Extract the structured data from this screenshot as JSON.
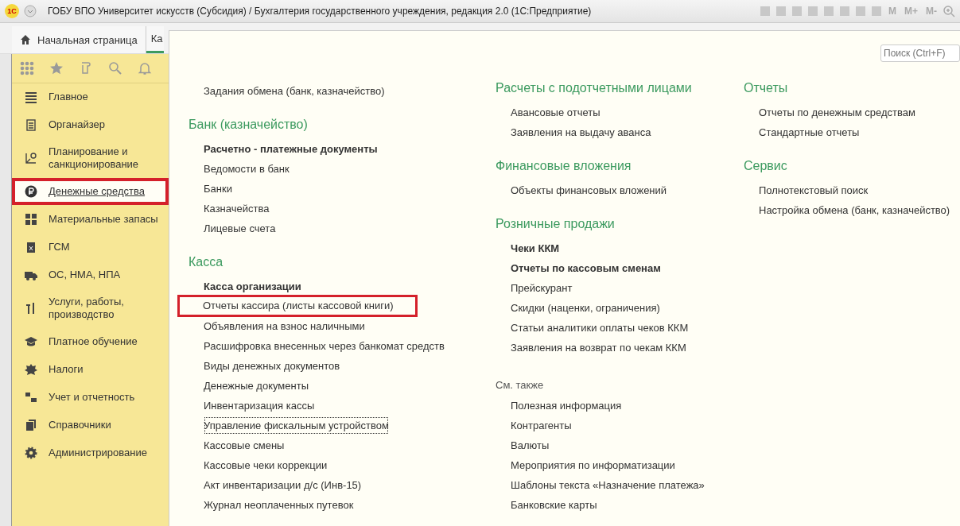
{
  "window": {
    "title": "ГОБУ ВПО Университет искусств (Субсидия) / Бухгалтерия государственного учреждения, редакция 2.0  (1С:Предприятие)",
    "logo": "1С",
    "memory_buttons": [
      "M",
      "M+",
      "M-"
    ]
  },
  "tabs": [
    {
      "label": "Начальная страница",
      "selected": false
    },
    {
      "label": "Ка",
      "selected": true
    }
  ],
  "sidebar": {
    "items": [
      {
        "label": "Главное",
        "selected": false,
        "marked": false
      },
      {
        "label": "Органайзер",
        "selected": false,
        "marked": false
      },
      {
        "label": "Планирование и санкционирование",
        "selected": false,
        "marked": false
      },
      {
        "label": "Денежные средства",
        "selected": true,
        "marked": true
      },
      {
        "label": "Материальные запасы",
        "selected": false,
        "marked": false
      },
      {
        "label": "ГСМ",
        "selected": false,
        "marked": false
      },
      {
        "label": "ОС, НМА, НПА",
        "selected": false,
        "marked": false
      },
      {
        "label": "Услуги, работы, производство",
        "selected": false,
        "marked": false
      },
      {
        "label": "Платное обучение",
        "selected": false,
        "marked": false
      },
      {
        "label": "Налоги",
        "selected": false,
        "marked": false
      },
      {
        "label": "Учет и отчетность",
        "selected": false,
        "marked": false
      },
      {
        "label": "Справочники",
        "selected": false,
        "marked": false
      },
      {
        "label": "Администрирование",
        "selected": false,
        "marked": false
      }
    ]
  },
  "search": {
    "placeholder": "Поиск (Ctrl+F)"
  },
  "columns": [
    {
      "sections": [
        {
          "kind": "plain",
          "items": [
            {
              "label": "Задания обмена (банк, казначейство)",
              "bold": false,
              "marked": false,
              "focused": false
            }
          ]
        },
        {
          "kind": "group",
          "title": "Банк (казначейство)",
          "items": [
            {
              "label": "Расчетно - платежные документы",
              "bold": true,
              "marked": false,
              "focused": false
            },
            {
              "label": "Ведомости в банк",
              "bold": false,
              "marked": false,
              "focused": false
            },
            {
              "label": "Банки",
              "bold": false,
              "marked": false,
              "focused": false
            },
            {
              "label": "Казначейства",
              "bold": false,
              "marked": false,
              "focused": false
            },
            {
              "label": "Лицевые счета",
              "bold": false,
              "marked": false,
              "focused": false
            }
          ]
        },
        {
          "kind": "group",
          "title": "Касса",
          "items": [
            {
              "label": "Касса организации",
              "bold": true,
              "marked": false,
              "focused": false
            },
            {
              "label": "Отчеты кассира (листы кассовой книги)",
              "bold": false,
              "marked": true,
              "focused": false
            },
            {
              "label": "Объявления на взнос наличными",
              "bold": false,
              "marked": false,
              "focused": false
            },
            {
              "label": "Расшифровка внесенных через банкомат средств",
              "bold": false,
              "marked": false,
              "focused": false
            },
            {
              "label": "Виды денежных документов",
              "bold": false,
              "marked": false,
              "focused": false
            },
            {
              "label": "Денежные документы",
              "bold": false,
              "marked": false,
              "focused": false
            },
            {
              "label": "Инвентаризация кассы",
              "bold": false,
              "marked": false,
              "focused": false
            },
            {
              "label": "Управление фискальным устройством",
              "bold": false,
              "marked": false,
              "focused": true
            },
            {
              "label": "Кассовые смены",
              "bold": false,
              "marked": false,
              "focused": false
            },
            {
              "label": "Кассовые чеки коррекции",
              "bold": false,
              "marked": false,
              "focused": false
            },
            {
              "label": "Акт инвентаризации д/с (Инв-15)",
              "bold": false,
              "marked": false,
              "focused": false
            },
            {
              "label": "Журнал неоплаченных путевок",
              "bold": false,
              "marked": false,
              "focused": false
            }
          ]
        }
      ]
    },
    {
      "sections": [
        {
          "kind": "group",
          "title": "Расчеты с подотчетными лицами",
          "items": [
            {
              "label": "Авансовые отчеты",
              "bold": false,
              "marked": false,
              "focused": false
            },
            {
              "label": "Заявления на выдачу аванса",
              "bold": false,
              "marked": false,
              "focused": false
            }
          ]
        },
        {
          "kind": "group",
          "title": "Финансовые вложения",
          "items": [
            {
              "label": "Объекты финансовых вложений",
              "bold": false,
              "marked": false,
              "focused": false
            }
          ]
        },
        {
          "kind": "group",
          "title": "Розничные продажи",
          "items": [
            {
              "label": "Чеки ККМ",
              "bold": true,
              "marked": false,
              "focused": false
            },
            {
              "label": "Отчеты по кассовым сменам",
              "bold": true,
              "marked": false,
              "focused": false
            },
            {
              "label": "Прейскурант",
              "bold": false,
              "marked": false,
              "focused": false
            },
            {
              "label": "Скидки (наценки, ограничения)",
              "bold": false,
              "marked": false,
              "focused": false
            },
            {
              "label": "Статьи аналитики оплаты чеков ККМ",
              "bold": false,
              "marked": false,
              "focused": false
            },
            {
              "label": "Заявления на возврат по чекам ККМ",
              "bold": false,
              "marked": false,
              "focused": false
            }
          ]
        },
        {
          "kind": "see_also",
          "title": "См. также",
          "items": [
            {
              "label": "Полезная информация",
              "bold": false,
              "marked": false,
              "focused": false
            },
            {
              "label": "Контрагенты",
              "bold": false,
              "marked": false,
              "focused": false
            },
            {
              "label": "Валюты",
              "bold": false,
              "marked": false,
              "focused": false
            },
            {
              "label": "Мероприятия по информатизации",
              "bold": false,
              "marked": false,
              "focused": false
            },
            {
              "label": "Шаблоны текста «Назначение платежа»",
              "bold": false,
              "marked": false,
              "focused": false
            },
            {
              "label": "Банковские карты",
              "bold": false,
              "marked": false,
              "focused": false
            }
          ]
        }
      ]
    },
    {
      "sections": [
        {
          "kind": "group",
          "title": "Отчеты",
          "items": [
            {
              "label": "Отчеты по денежным средствам",
              "bold": false,
              "marked": false,
              "focused": false
            },
            {
              "label": "Стандартные отчеты",
              "bold": false,
              "marked": false,
              "focused": false
            }
          ]
        },
        {
          "kind": "group",
          "title": "Сервис",
          "items": [
            {
              "label": "Полнотекстовый поиск",
              "bold": false,
              "marked": false,
              "focused": false
            },
            {
              "label": "Настройка обмена (банк, казначейство)",
              "bold": false,
              "marked": false,
              "focused": false
            }
          ]
        }
      ]
    }
  ]
}
